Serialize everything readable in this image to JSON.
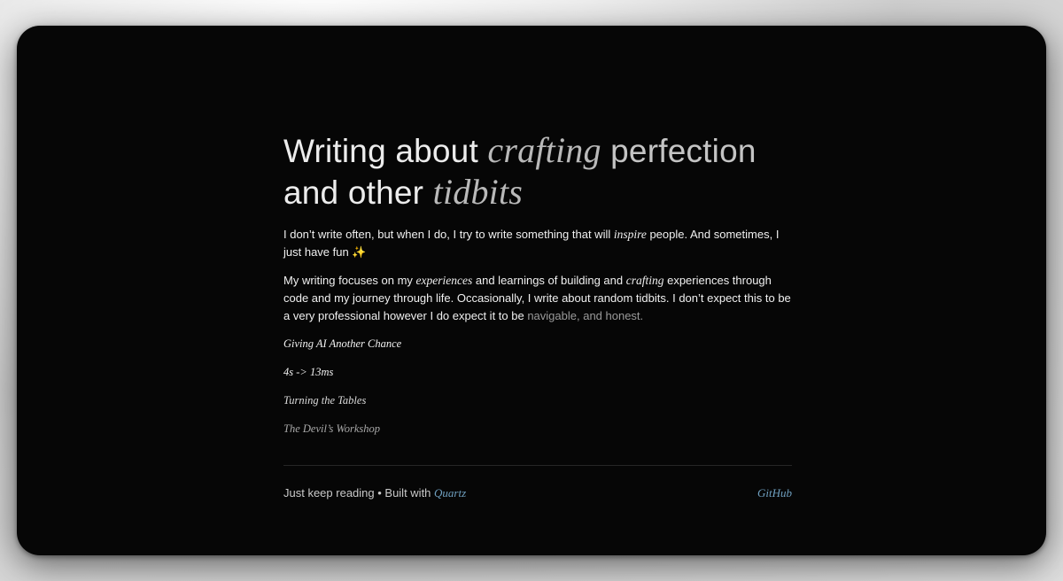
{
  "hero": {
    "line1_a": "Writing about ",
    "line1_b": "crafting",
    "line1_c": " perfection",
    "line2_a": "and other ",
    "line2_b": "tidbits"
  },
  "intro": {
    "a": "I don’t write often, but when I do, I try to write something that will ",
    "b": "inspire",
    "c": " people. And sometimes, I just have fun ✨"
  },
  "focus": {
    "a": "My writing focuses on my ",
    "b": "experiences",
    "c": " and learnings of building and ",
    "d": "crafting",
    "e": " experiences through code and my journey through life. Occasionally, I write about random tidbits. I don’t expect this to be a very professional however I do expect it to be ",
    "f": "navigable, and honest."
  },
  "posts": [
    {
      "title": "Giving AI Another Chance"
    },
    {
      "title": "4s -> 13ms"
    },
    {
      "title": "Turning the Tables"
    },
    {
      "title": "The Devil’s Workshop"
    }
  ],
  "footer": {
    "text": "Just keep reading • Built with ",
    "quartz_link": "Quartz",
    "github_link": "GitHub"
  }
}
